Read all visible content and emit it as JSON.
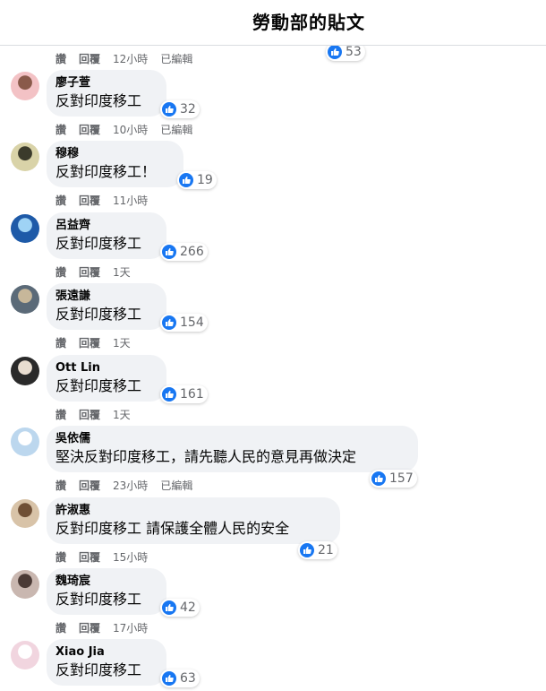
{
  "header": {
    "title": "勞動部的貼文"
  },
  "actions": {
    "like": "讚",
    "reply": "回覆",
    "edited": "已編輯"
  },
  "top_partial": {
    "time": "12小時",
    "reactions": "53"
  },
  "comments": [
    {
      "name": "廖子萱",
      "text": "反對印度移工",
      "reactions": "32",
      "time": "10小時",
      "edited": true
    },
    {
      "name": "穆穆",
      "text": "反對印度移工！",
      "reactions": "19",
      "time": "11小時",
      "edited": false
    },
    {
      "name": "呂益齊",
      "text": "反對印度移工",
      "reactions": "266",
      "time": "1天",
      "edited": false
    },
    {
      "name": "張遠謙",
      "text": "反對印度移工",
      "reactions": "154",
      "time": "1天",
      "edited": false
    },
    {
      "name": "Ott Lin",
      "text": "反對印度移工",
      "reactions": "161",
      "time": "1天",
      "edited": false
    },
    {
      "name": "吳依儒",
      "text": "堅決反對印度移工，請先聽人民的意見再做決定",
      "reactions": "157",
      "time": "23小時",
      "edited": true
    },
    {
      "name": "許淑惠",
      "text": "反對印度移工 請保護全體人民的安全",
      "reactions": "21",
      "time": "15小時",
      "edited": false
    },
    {
      "name": "魏琦宸",
      "text": "反對印度移工",
      "reactions": "42",
      "time": "17小時",
      "edited": false
    },
    {
      "name": "Xiao Jia",
      "text": "反對印度移工",
      "reactions": "63",
      "time": "",
      "edited": false
    }
  ],
  "colors": {
    "like_blue": "#1877f2",
    "bubble_bg": "#f0f2f5",
    "meta_gray": "#65676b"
  },
  "icons": [
    "like-icon",
    "avatar"
  ]
}
